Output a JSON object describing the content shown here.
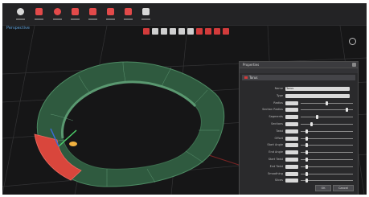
{
  "app": {
    "view_label": "Perspective",
    "colors": {
      "background": "#1b1b1c",
      "toolbar": "#232325",
      "torus_green": "#3e6e4e",
      "torus_selected_red": "#d9463c",
      "axis_red": "#8a2a2a",
      "grid": "#3a3a3c",
      "accent_blue": "#5fa0d8"
    }
  },
  "toolbar": {
    "items": [
      {
        "icon": "new-icon"
      },
      {
        "icon": "brush-icon"
      },
      {
        "icon": "sphere-icon"
      },
      {
        "icon": "cube-icon"
      },
      {
        "icon": "plus-icon"
      },
      {
        "icon": "move-icon"
      },
      {
        "icon": "grid-icon"
      },
      {
        "icon": "wrench-icon"
      }
    ]
  },
  "viewport_tools": [
    {
      "icon": "select-icon",
      "color": "red"
    },
    {
      "icon": "move-icon"
    },
    {
      "icon": "rotate-icon"
    },
    {
      "icon": "scale-icon"
    },
    {
      "icon": "camera-icon"
    },
    {
      "icon": "light-icon"
    },
    {
      "icon": "render-icon",
      "color": "red"
    },
    {
      "icon": "material-icon",
      "color": "red"
    },
    {
      "icon": "settings-icon",
      "color": "red"
    },
    {
      "icon": "plane-icon",
      "color": "red"
    }
  ],
  "panel": {
    "title": "Properties",
    "subtitle": "",
    "object_name": "Torus",
    "properties": [
      {
        "label": "Name",
        "value": "Torus",
        "slider": null
      },
      {
        "label": "Type",
        "value": "",
        "slider": null
      },
      {
        "label": "Radius",
        "value": "",
        "slider": 0.5
      },
      {
        "label": "Section Radius",
        "value": "",
        "slider": 0.9
      },
      {
        "label": "Segments",
        "value": "",
        "slider": 0.3
      },
      {
        "label": "Sections",
        "value": "",
        "slider": 0.2
      },
      {
        "label": "Twist",
        "value": "",
        "slider": 0.1
      },
      {
        "label": "Offset",
        "value": "",
        "slider": 0.1
      },
      {
        "label": "Start Angle",
        "value": "",
        "slider": 0.1
      },
      {
        "label": "End Angle",
        "value": "",
        "slider": 0.1
      },
      {
        "label": "Start Twist",
        "value": "",
        "slider": 0.1
      },
      {
        "label": "End Twist",
        "value": "",
        "slider": 0.1
      },
      {
        "label": "Smoothing",
        "value": "",
        "slider": 0.1
      },
      {
        "label": "Slices",
        "value": "",
        "slider": 0.1
      }
    ],
    "ok_label": "OK",
    "cancel_label": "Cancel"
  }
}
